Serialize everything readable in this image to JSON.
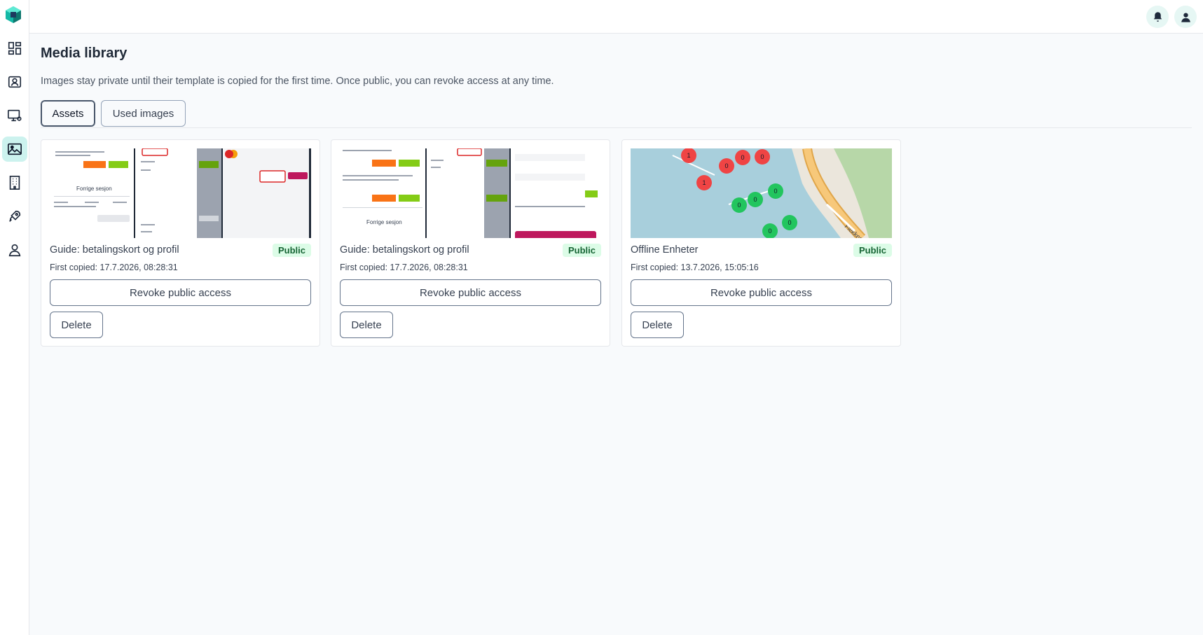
{
  "header": {
    "notifications_label": "Notifications",
    "account_label": "Account"
  },
  "page": {
    "title": "Media library",
    "description": "Images stay private until their template is copied for the first time. Once public, you can revoke access at any time."
  },
  "tabs": [
    {
      "label": "Assets",
      "active": true
    },
    {
      "label": "Used images",
      "active": false
    }
  ],
  "cards": [
    {
      "title": "Guide: betalingskort og profil",
      "badge": "Public",
      "first_copied": "First copied: 17.7.2026, 08:28:31",
      "revoke_label": "Revoke public access",
      "delete_label": "Delete"
    },
    {
      "title": "Guide: betalingskort og profil",
      "badge": "Public",
      "first_copied": "First copied: 17.7.2026, 08:28:31",
      "revoke_label": "Revoke public access",
      "delete_label": "Delete"
    },
    {
      "title": "Offline Enheter",
      "badge": "Public",
      "first_copied": "First copied: 13.7.2026, 15:05:16",
      "revoke_label": "Revoke public access",
      "delete_label": "Delete"
    }
  ],
  "thumb_text": {
    "previous_session": "Forrige sesjon",
    "flekkeroy": "Flekkerøy",
    "map_markers_red": [
      "1",
      "0",
      "0",
      "0",
      "1"
    ],
    "map_markers_green": [
      "0",
      "0",
      "0",
      "0",
      "0"
    ]
  },
  "colors": {
    "accent": "#14b8a6",
    "active_nav_bg": "#ccf2ee",
    "badge_bg": "#dcfce7",
    "badge_text": "#166534",
    "marker_red": "#ef4444",
    "marker_green": "#22c55e"
  }
}
